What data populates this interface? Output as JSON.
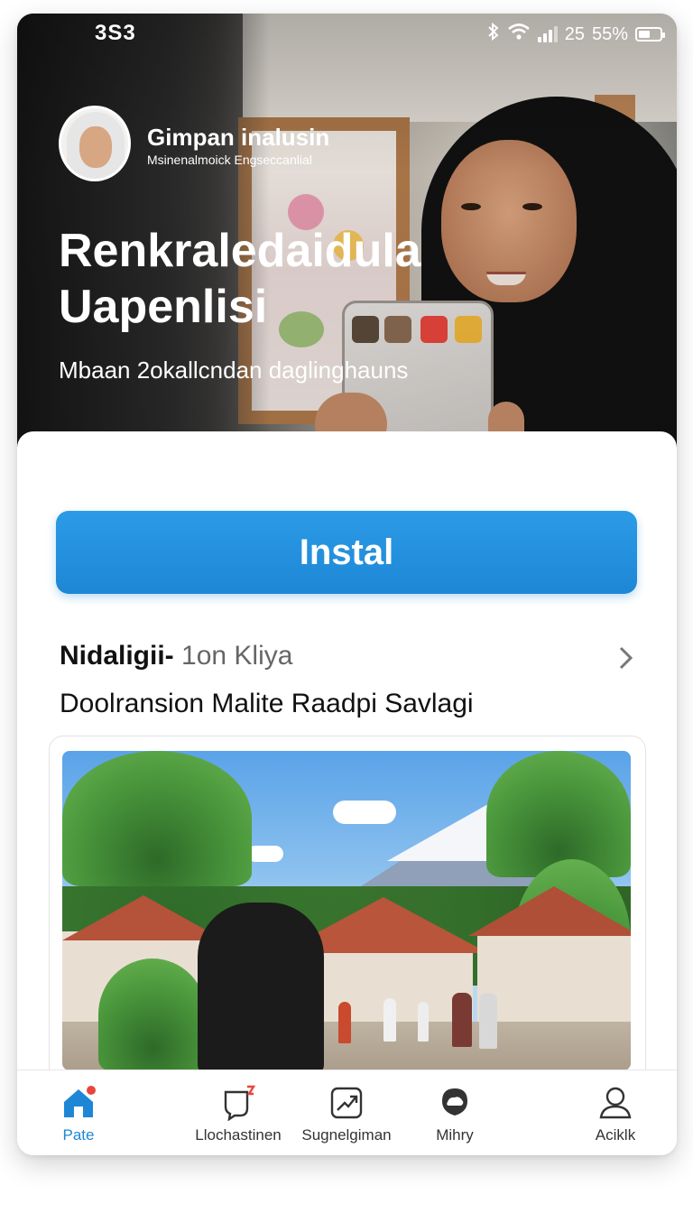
{
  "status_bar": {
    "time": "3S3",
    "network": "25",
    "battery_percent_label": "55%",
    "battery_level": 0.55
  },
  "profile": {
    "name": "Gimpan inalusin",
    "subtitle": "Msinenalmoick Engseccanlial"
  },
  "hero": {
    "title": "Renkraledaidula Uapenlisi",
    "subtitle": "Mbaan 2okallcndan daglinghauns"
  },
  "install_button": {
    "label": "Instal"
  },
  "section": {
    "title_bold": "Nidaligii-",
    "title_muted": "1on  Kliya",
    "subtitle": "Doolransion Malite Raadpi Savlagi"
  },
  "tabs": [
    {
      "label": "Pate",
      "icon": "home-icon",
      "active": true
    },
    {
      "label": "Llochastinen",
      "icon": "chat-badge-icon",
      "active": false
    },
    {
      "label": "Sugnelgiman",
      "icon": "trend-icon",
      "active": false
    },
    {
      "label": "Mihry",
      "icon": "cloud-chat-icon",
      "active": false
    },
    {
      "label": "Aciklk",
      "icon": "user-icon",
      "active": false
    }
  ],
  "colors": {
    "accent": "#1d87d6",
    "badge": "#e8453c"
  }
}
